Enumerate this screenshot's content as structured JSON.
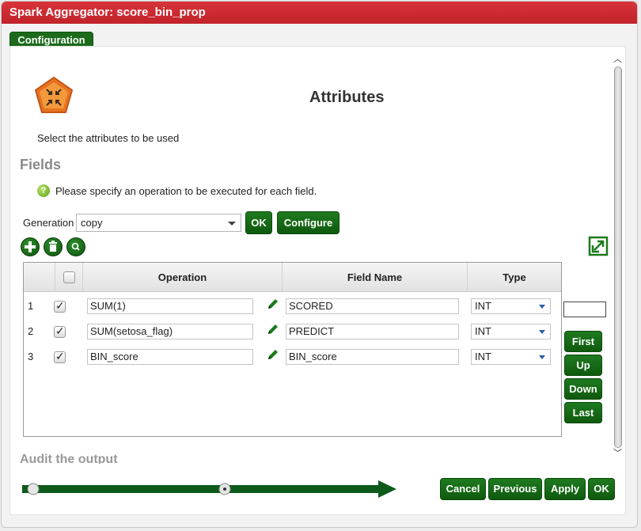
{
  "window": {
    "title": "Spark Aggregator: score_bin_prop"
  },
  "tab": {
    "label": "Configuration"
  },
  "header": {
    "title": "Attributes",
    "instruction": "Select the attributes to be used"
  },
  "fields": {
    "heading": "Fields",
    "hint": "Please specify an operation to be executed for each field.",
    "help_icon": "?"
  },
  "generation": {
    "label": "Generation",
    "value": "copy",
    "ok_label": "OK",
    "configure_label": "Configure"
  },
  "toolbar": {
    "add_icon": "+",
    "delete_icon": "trash",
    "search_icon": "search"
  },
  "table": {
    "columns": [
      "Operation",
      "Field Name",
      "Type"
    ],
    "rows": [
      {
        "num": "1",
        "operation": "SUM(1)",
        "field": "SCORED",
        "type": "INT"
      },
      {
        "num": "2",
        "operation": "SUM(setosa_flag)",
        "field": "PREDICT",
        "type": "INT"
      },
      {
        "num": "3",
        "operation": "BIN_score",
        "field": "BIN_score",
        "type": "INT"
      }
    ]
  },
  "nav": {
    "first": "First",
    "up": "Up",
    "down": "Down",
    "last": "Last",
    "position_value": ""
  },
  "section2": {
    "heading": "Audit the output"
  },
  "footer": {
    "cancel": "Cancel",
    "previous": "Previous",
    "apply": "Apply",
    "ok": "OK"
  },
  "colors": {
    "title_red": "#c1232b",
    "button_green": "#0f5a0f",
    "heading_gray": "#8a8a8a",
    "gem_orange": "#e8731f"
  }
}
